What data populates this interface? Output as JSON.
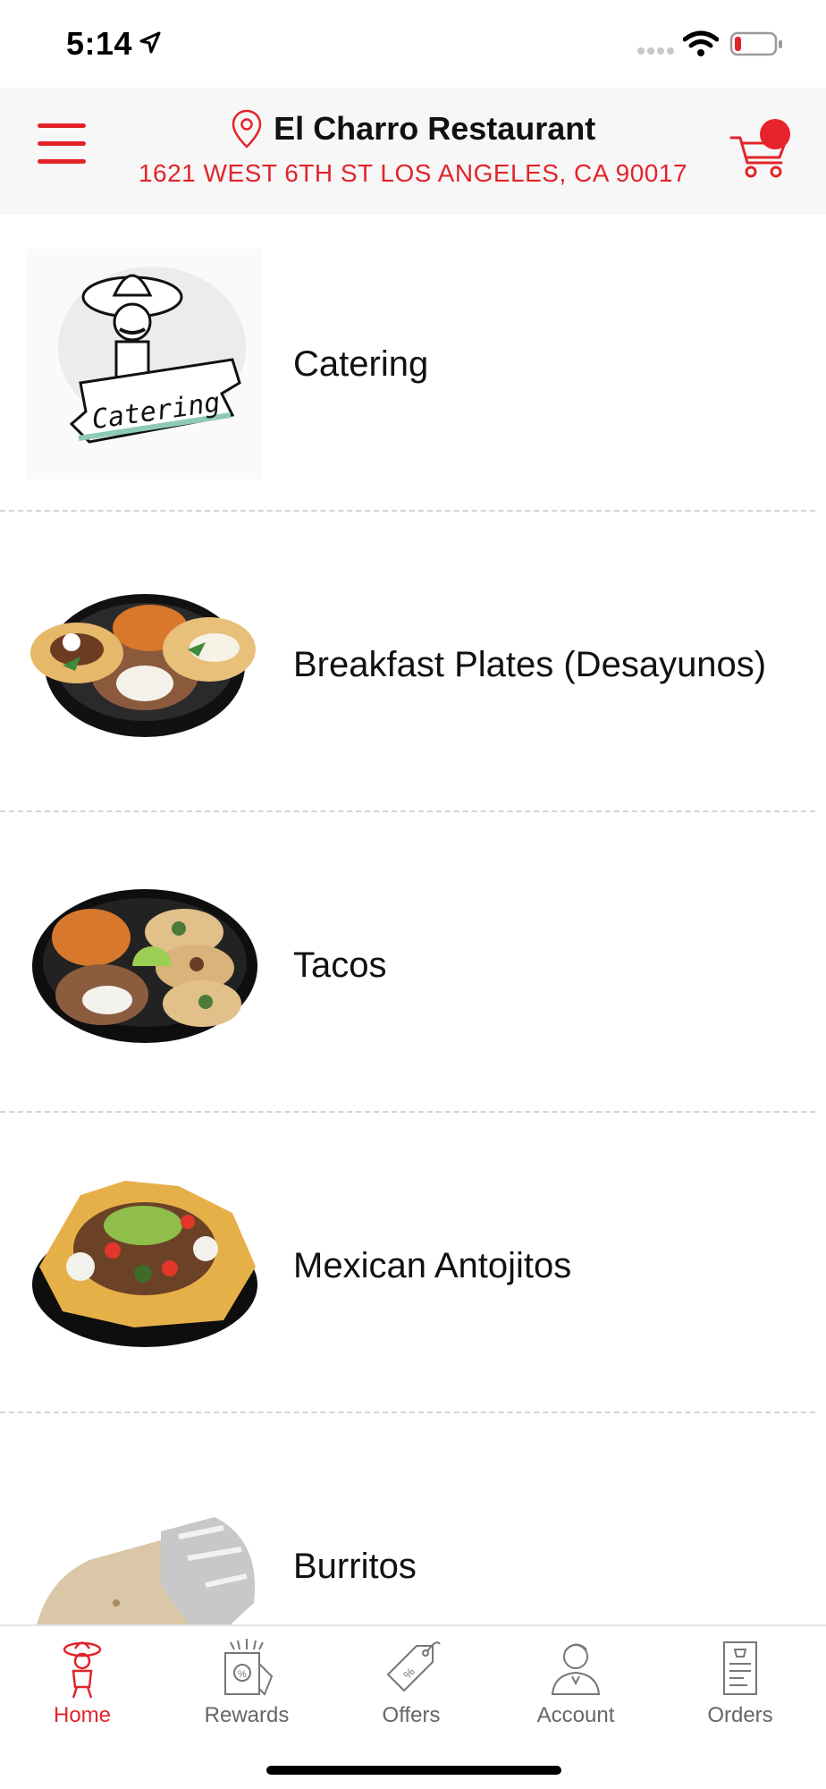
{
  "status_bar": {
    "time": "5:14"
  },
  "header": {
    "restaurant_name": "El Charro Restaurant",
    "address": "1621 WEST 6TH ST LOS ANGELES, CA 90017",
    "icons": {
      "menu": "hamburger-menu-icon",
      "pin": "location-pin-icon",
      "cart": "shopping-cart-icon"
    }
  },
  "categories": [
    {
      "label": "Catering",
      "image": "catering-illustration"
    },
    {
      "label": "Breakfast Plates (Desayunos)",
      "image": "breakfast-plate-photo"
    },
    {
      "label": "Tacos",
      "image": "tacos-plate-photo"
    },
    {
      "label": "Mexican Antojitos",
      "image": "nachos-plate-photo"
    },
    {
      "label": "Burritos",
      "image": "burrito-photo"
    }
  ],
  "tabs": [
    {
      "label": "Home",
      "icon": "mascot-icon",
      "active": true
    },
    {
      "label": "Rewards",
      "icon": "rewards-icon",
      "active": false
    },
    {
      "label": "Offers",
      "icon": "price-tag-icon",
      "active": false
    },
    {
      "label": "Account",
      "icon": "user-icon",
      "active": false
    },
    {
      "label": "Orders",
      "icon": "receipt-icon",
      "active": false
    }
  ],
  "colors": {
    "accent": "#e2242a",
    "header_bg": "#f7f7f7",
    "tab_inactive": "#666666"
  }
}
